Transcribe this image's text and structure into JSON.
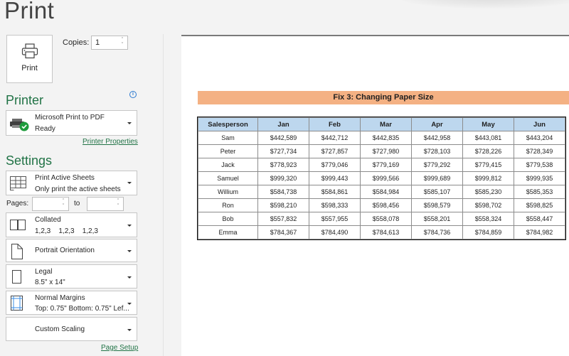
{
  "page": {
    "title": "Print"
  },
  "print_button": {
    "label": "Print",
    "icon": "printer-icon"
  },
  "copies": {
    "label": "Copies:",
    "value": "1"
  },
  "printer": {
    "section_title": "Printer",
    "info_icon": "info-icon",
    "name": "Microsoft Print to PDF",
    "status": "Ready",
    "properties_link": "Printer Properties"
  },
  "settings": {
    "section_title": "Settings",
    "print_what": {
      "title": "Print Active Sheets",
      "subtitle": "Only print the active sheets"
    },
    "pages": {
      "label": "Pages:",
      "from_value": "",
      "to_label": "to",
      "to_value": ""
    },
    "collation": {
      "title": "Collated",
      "subtitle": "1,2,3    1,2,3    1,2,3"
    },
    "orientation": {
      "title": "Portrait Orientation"
    },
    "paper_size": {
      "title": "Legal",
      "subtitle": "8.5\" x 14\""
    },
    "margins": {
      "title": "Normal Margins",
      "subtitle": "Top: 0.75\" Bottom: 0.75\" Lef..."
    },
    "scaling": {
      "title": "Custom Scaling"
    },
    "page_setup_link": "Page Setup"
  },
  "preview": {
    "sheet_title": "Fix 3: Changing Paper Size",
    "colors": {
      "title_fill": "#f4b183",
      "header_fill": "#bdd7ee"
    },
    "table": {
      "headers": [
        "Salesperson",
        "Jan",
        "Feb",
        "Mar",
        "Apr",
        "May",
        "Jun"
      ],
      "rows": [
        [
          "Sam",
          "$442,589",
          "$442,712",
          "$442,835",
          "$442,958",
          "$443,081",
          "$443,204"
        ],
        [
          "Peter",
          "$727,734",
          "$727,857",
          "$727,980",
          "$728,103",
          "$728,226",
          "$728,349"
        ],
        [
          "Jack",
          "$778,923",
          "$779,046",
          "$779,169",
          "$779,292",
          "$779,415",
          "$779,538"
        ],
        [
          "Samuel",
          "$999,320",
          "$999,443",
          "$999,566",
          "$999,689",
          "$999,812",
          "$999,935"
        ],
        [
          "Willium",
          "$584,738",
          "$584,861",
          "$584,984",
          "$585,107",
          "$585,230",
          "$585,353"
        ],
        [
          "Ron",
          "$598,210",
          "$598,333",
          "$598,456",
          "$598,579",
          "$598,702",
          "$598,825"
        ],
        [
          "Bob",
          "$557,832",
          "$557,955",
          "$558,078",
          "$558,201",
          "$558,324",
          "$558,447"
        ],
        [
          "Emma",
          "$784,367",
          "$784,490",
          "$784,613",
          "$784,736",
          "$784,859",
          "$784,982"
        ]
      ]
    }
  }
}
